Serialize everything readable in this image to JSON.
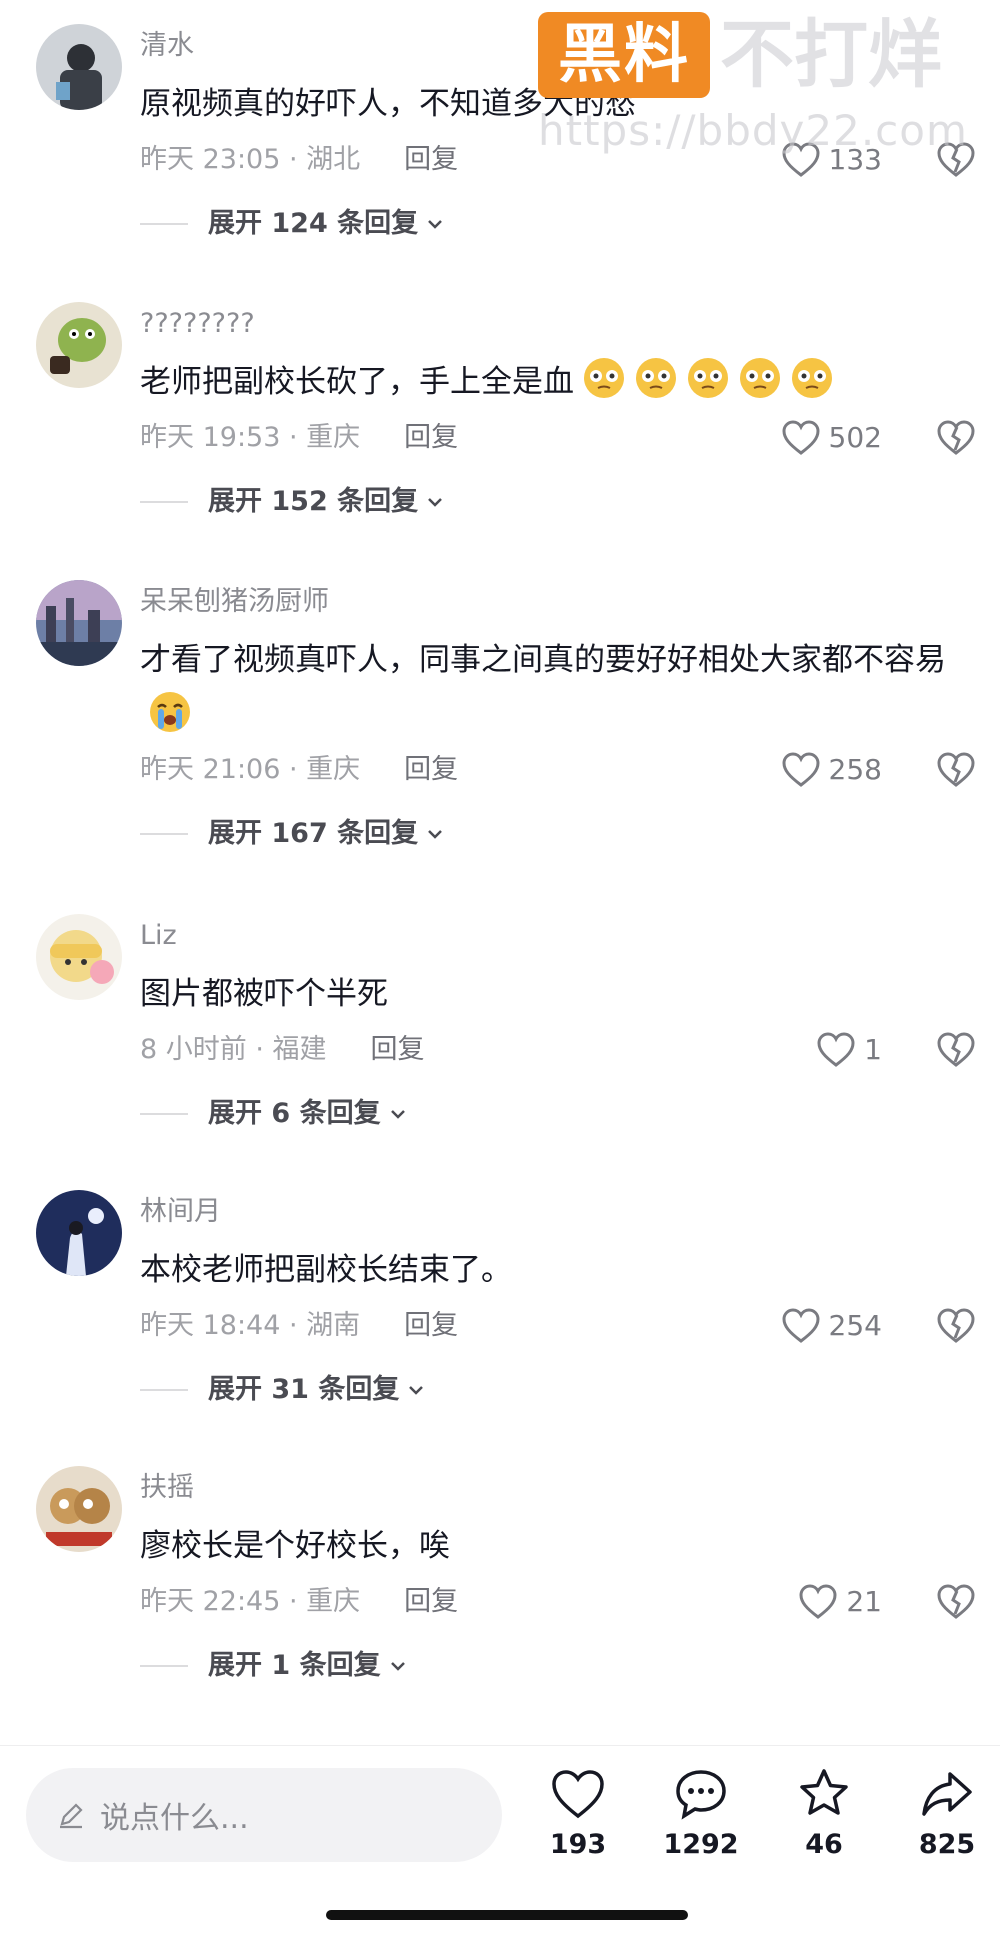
{
  "watermark": {
    "badge": "黑料",
    "rest": "不打烊",
    "url": "https://bbdy22.com"
  },
  "comments": [
    {
      "name": "清水",
      "text": "原视频真的好吓人，不知道多大的愁",
      "time": "昨天 23:05 · 湖北",
      "reply": "回复",
      "likes": "133",
      "expand": "展开 124 条回复",
      "avatar_color": "#5a6270",
      "emoji_count": 0
    },
    {
      "name": "????????",
      "text": "老师把副校长砍了，手上全是血",
      "time": "昨天 19:53 · 重庆",
      "reply": "回复",
      "likes": "502",
      "expand": "展开 152 条回复",
      "avatar_color": "#9bb86a",
      "emoji_count": 5
    },
    {
      "name": "呆呆刨猪汤厨师",
      "text": "才看了视频真吓人，同事之间真的要好好相处大家都不容易",
      "time": "昨天 21:06 · 重庆",
      "reply": "回复",
      "likes": "258",
      "expand": "展开 167 条回复",
      "avatar_color": "#7d6a8a",
      "emoji_count": 1
    },
    {
      "name": "Liz",
      "text": "图片都被吓个半死",
      "time": "8 小时前 · 福建",
      "reply": "回复",
      "likes": "1",
      "expand": "展开 6 条回复",
      "avatar_color": "#f1e3b8",
      "emoji_count": 0
    },
    {
      "name": "林间月",
      "text": "本校老师把副校长结束了。",
      "time": "昨天 18:44 · 湖南",
      "reply": "回复",
      "likes": "254",
      "expand": "展开 31 条回复",
      "avatar_color": "#3b4a78",
      "emoji_count": 0
    },
    {
      "name": "扶摇",
      "text": "廖校长是个好校长，唉",
      "time": "昨天 22:45 · 重庆",
      "reply": "回复",
      "likes": "21",
      "expand": "展开 1 条回复",
      "avatar_color": "#c7a06a",
      "emoji_count": 0
    }
  ],
  "bottom_bar": {
    "input_placeholder": "说点什么...",
    "like_count": "193",
    "comment_count": "1292",
    "favorite_count": "46",
    "share_count": "825"
  },
  "icons": {
    "like": "heart-icon",
    "dislike": "broken-heart-icon",
    "comment": "comment-bubble-icon",
    "favorite": "star-icon",
    "share": "share-arrow-icon",
    "edit": "pencil-icon",
    "expand": "chevron-down-icon"
  },
  "colors": {
    "accent_badge": "#f08a24",
    "meta_text": "#a0a1a6",
    "name_text": "#8a8b91"
  }
}
